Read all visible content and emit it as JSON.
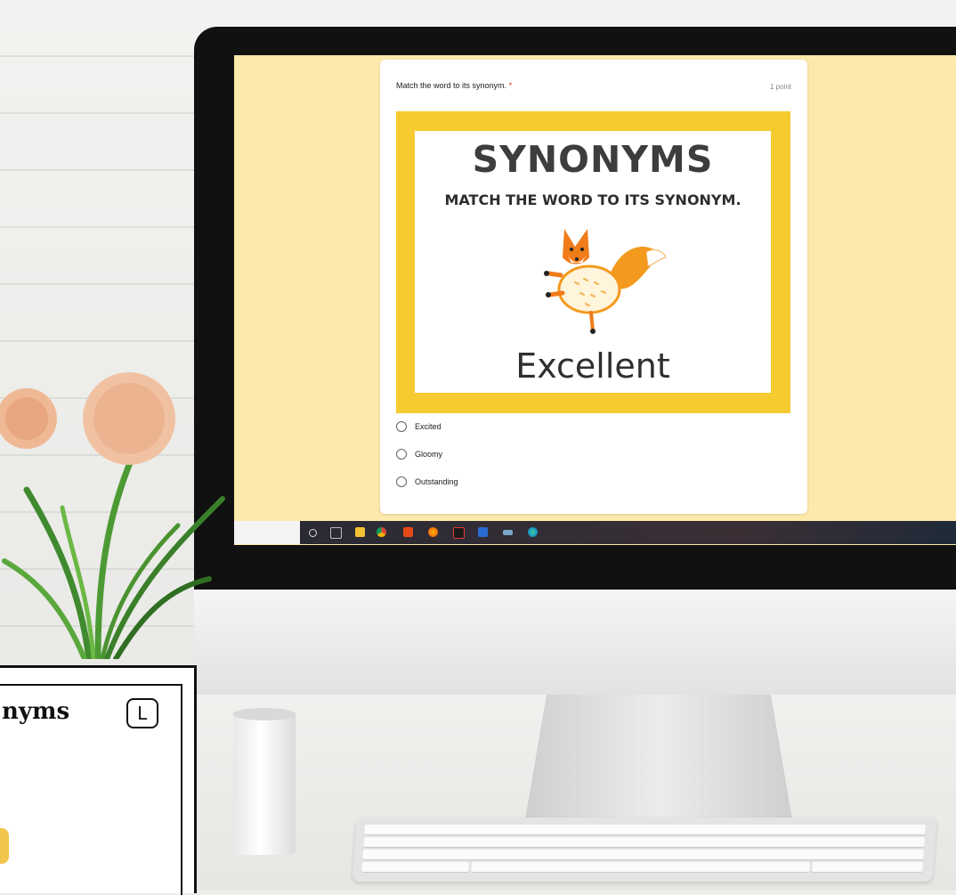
{
  "form": {
    "question": "Match the word to its synonym.",
    "required_marker": "*",
    "points": "1 point",
    "image": {
      "heading": "SYNONYMS",
      "subheading": "MATCH THE WORD TO ITS SYNONYM.",
      "word": "Excellent",
      "frame_color": "#f5cb2f"
    },
    "options": [
      {
        "label": "Excited",
        "selected": false
      },
      {
        "label": "Gloomy",
        "selected": false
      },
      {
        "label": "Outstanding",
        "selected": false
      }
    ]
  },
  "taskbar": {
    "icons": [
      "search-icon",
      "task-view-icon",
      "file-explorer-icon",
      "chrome-icon",
      "office-icon",
      "firefox-icon",
      "acrobat-icon",
      "word-icon",
      "app-icon",
      "edge-icon"
    ]
  },
  "worksheet": {
    "title": "nyms",
    "badge": "L"
  }
}
